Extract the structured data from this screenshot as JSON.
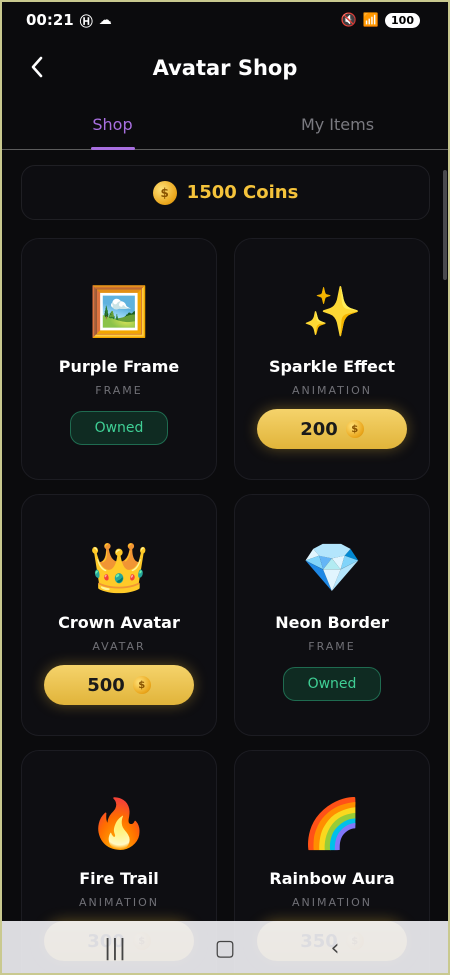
{
  "status_bar": {
    "time": "00:21",
    "left_icons": [
      "h-icon",
      "cloud-icon"
    ],
    "battery": "100"
  },
  "header": {
    "title": "Avatar Shop"
  },
  "tabs": [
    {
      "label": "Shop",
      "active": true
    },
    {
      "label": "My Items",
      "active": false
    }
  ],
  "coins": {
    "label": "1500 Coins"
  },
  "items": [
    {
      "icon": "🖼️",
      "name": "Purple Frame",
      "type": "FRAME",
      "state": "owned",
      "owned_label": "Owned"
    },
    {
      "icon": "✨",
      "name": "Sparkle Effect",
      "type": "ANIMATION",
      "state": "price",
      "price": "200"
    },
    {
      "icon": "👑",
      "name": "Crown Avatar",
      "type": "AVATAR",
      "state": "price",
      "price": "500"
    },
    {
      "icon": "💎",
      "name": "Neon Border",
      "type": "FRAME",
      "state": "owned",
      "owned_label": "Owned"
    },
    {
      "icon": "🔥",
      "name": "Fire Trail",
      "type": "ANIMATION",
      "state": "price",
      "price": "300"
    },
    {
      "icon": "🌈",
      "name": "Rainbow Aura",
      "type": "ANIMATION",
      "state": "price",
      "price": "350"
    }
  ],
  "colors": {
    "accent": "#a86fe0",
    "coin": "#f5c33b",
    "owned": "#3fcf95"
  }
}
